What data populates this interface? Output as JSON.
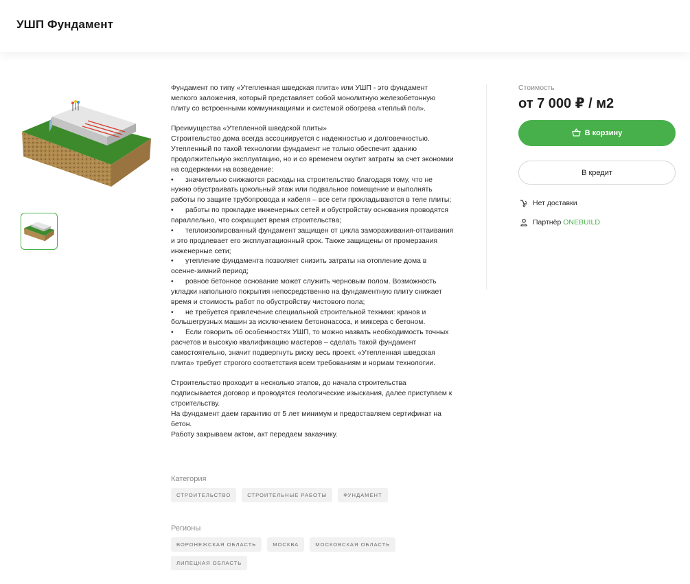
{
  "header": {
    "title": "УШП Фундамент"
  },
  "gallery": {
    "main_image": "foundation-slab-render",
    "thumbnail": "foundation-slab-render"
  },
  "description": {
    "paragraphs": [
      "Фундамент по типу «Утепленная шведская плита» или УШП - это фундамент мелкого заложения, который представляет собой монолитную железобетонную плиту со встроенными коммуникациями и системой обогрева «теплый пол».",
      "",
      "Преимущества «Утепленной шведской плиты»",
      "Строительство дома всегда ассоциируется с надежностью и долговечностью. Утепленный по такой технологии фундамент не только обеспечит зданию продолжительную эксплуатацию, но и со временем окупит затраты за счет экономии на содержании на возведение:",
      "•      значительно снижаются расходы на строительство благодаря тому, что не нужно обустраивать цокольный этаж или подвальное помещение и выполнять работы по защите трубопровода и кабеля – все сети прокладываются в теле плиты;",
      "•      работы по прокладке инженерных сетей и обустройству основания проводятся параллельно, что сокращает время строительства;",
      "•      теплоизолированный фундамент защищен от цикла замораживания-оттаивания и это продлевает его эксплуатационный срок. Также защищены от промерзания инженерные сети;",
      "•      утепление фундамента позволяет снизить затраты на отопление дома в осенне-зимний период;",
      "•      ровное бетонное основание может служить черновым полом. Возможность укладки напольного покрытия непосредственно на фундаментную плиту снижает время и стоимость работ по обустройству чистового пола;",
      "•      не требуется привлечение специальной строительной техники: кранов и большегрузных машин за исключением бетононасоса, и миксера с бетоном.",
      "•      Если говорить об особенностях УШП, то можно назвать необходимость точных расчетов и высокую квалификацию мастеров – сделать такой фундамент самостоятельно, значит подвергнуть риску весь проект. «Утепленная шведская плита» требует строгого соответствия всем требованиям и нормам технологии.",
      "",
      "Строительство проходит в несколько этапов, до начала строительства подписывается договор и проводятся геологические изыскания, далее приступаем к строительству.",
      "На фундамент даем гарантию от 5 лет минимум и предоставляем сертификат на бетон.",
      "Работу закрываем актом, акт передаем заказчику."
    ]
  },
  "category": {
    "label": "Категория",
    "tags": [
      "строительство",
      "строительные работы",
      "фундамент"
    ]
  },
  "regions": {
    "label": "Регионы",
    "tags": [
      "воронежская область",
      "москва",
      "московская область",
      "липецкая область"
    ]
  },
  "sidebar": {
    "price_label": "Стоимость",
    "price": "от 7 000 ₽ / м2",
    "cart_button": "В корзину",
    "credit_button": "В кредит",
    "delivery": "Нет доставки",
    "partner_prefix": "Партнёр",
    "partner_name": "ONEBUILD",
    "icons": {
      "cart": "basket-icon",
      "delivery": "no-delivery-icon",
      "partner": "person-icon"
    }
  },
  "colors": {
    "accent": "#47b04b"
  }
}
